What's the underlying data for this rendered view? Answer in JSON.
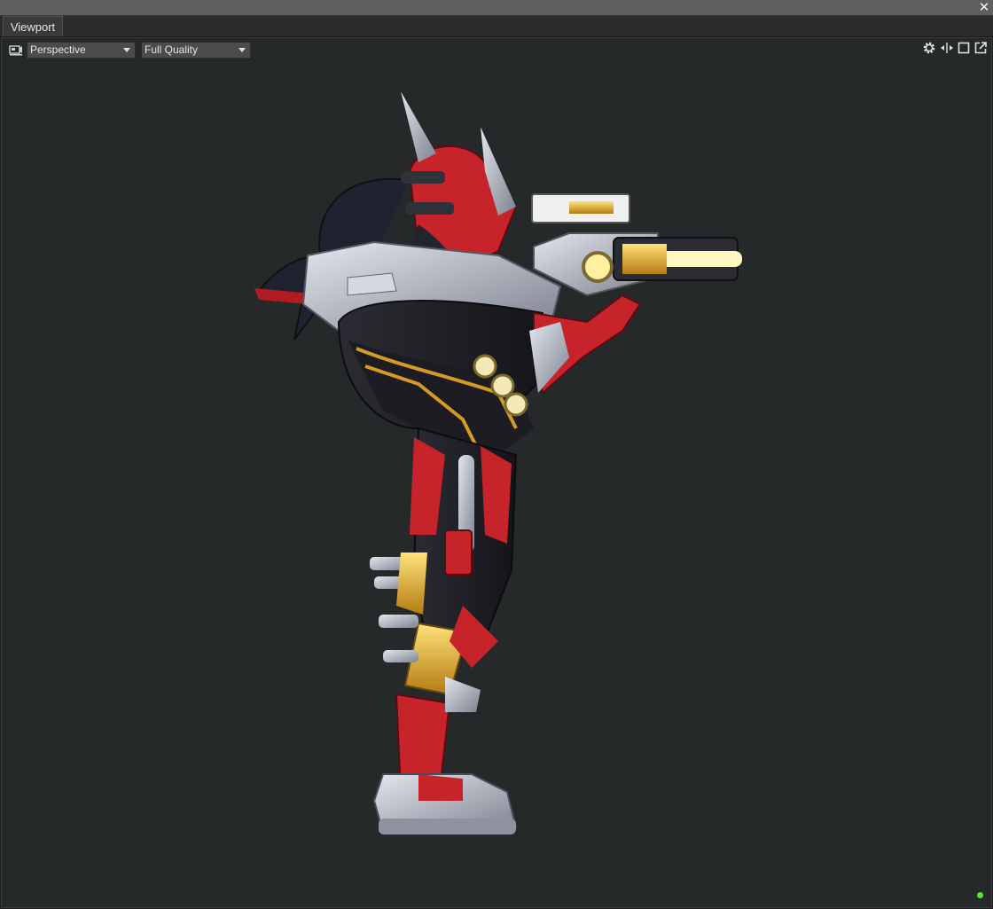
{
  "window": {
    "close_icon": "close-icon"
  },
  "tabs": [
    {
      "label": "Viewport"
    }
  ],
  "viewport": {
    "camera_icon": "camera-icon",
    "projection": {
      "value": "Perspective"
    },
    "quality": {
      "value": "Full Quality"
    },
    "right_tools": [
      "gear-icon",
      "split-arrows-icon",
      "maximize-icon",
      "popout-icon"
    ],
    "status_color": "#5ee03a"
  },
  "colors": {
    "background": "#26292a",
    "accent_red": "#c91f24",
    "accent_gold": "#d9a21e",
    "armor_silver": "#a9adb6"
  }
}
